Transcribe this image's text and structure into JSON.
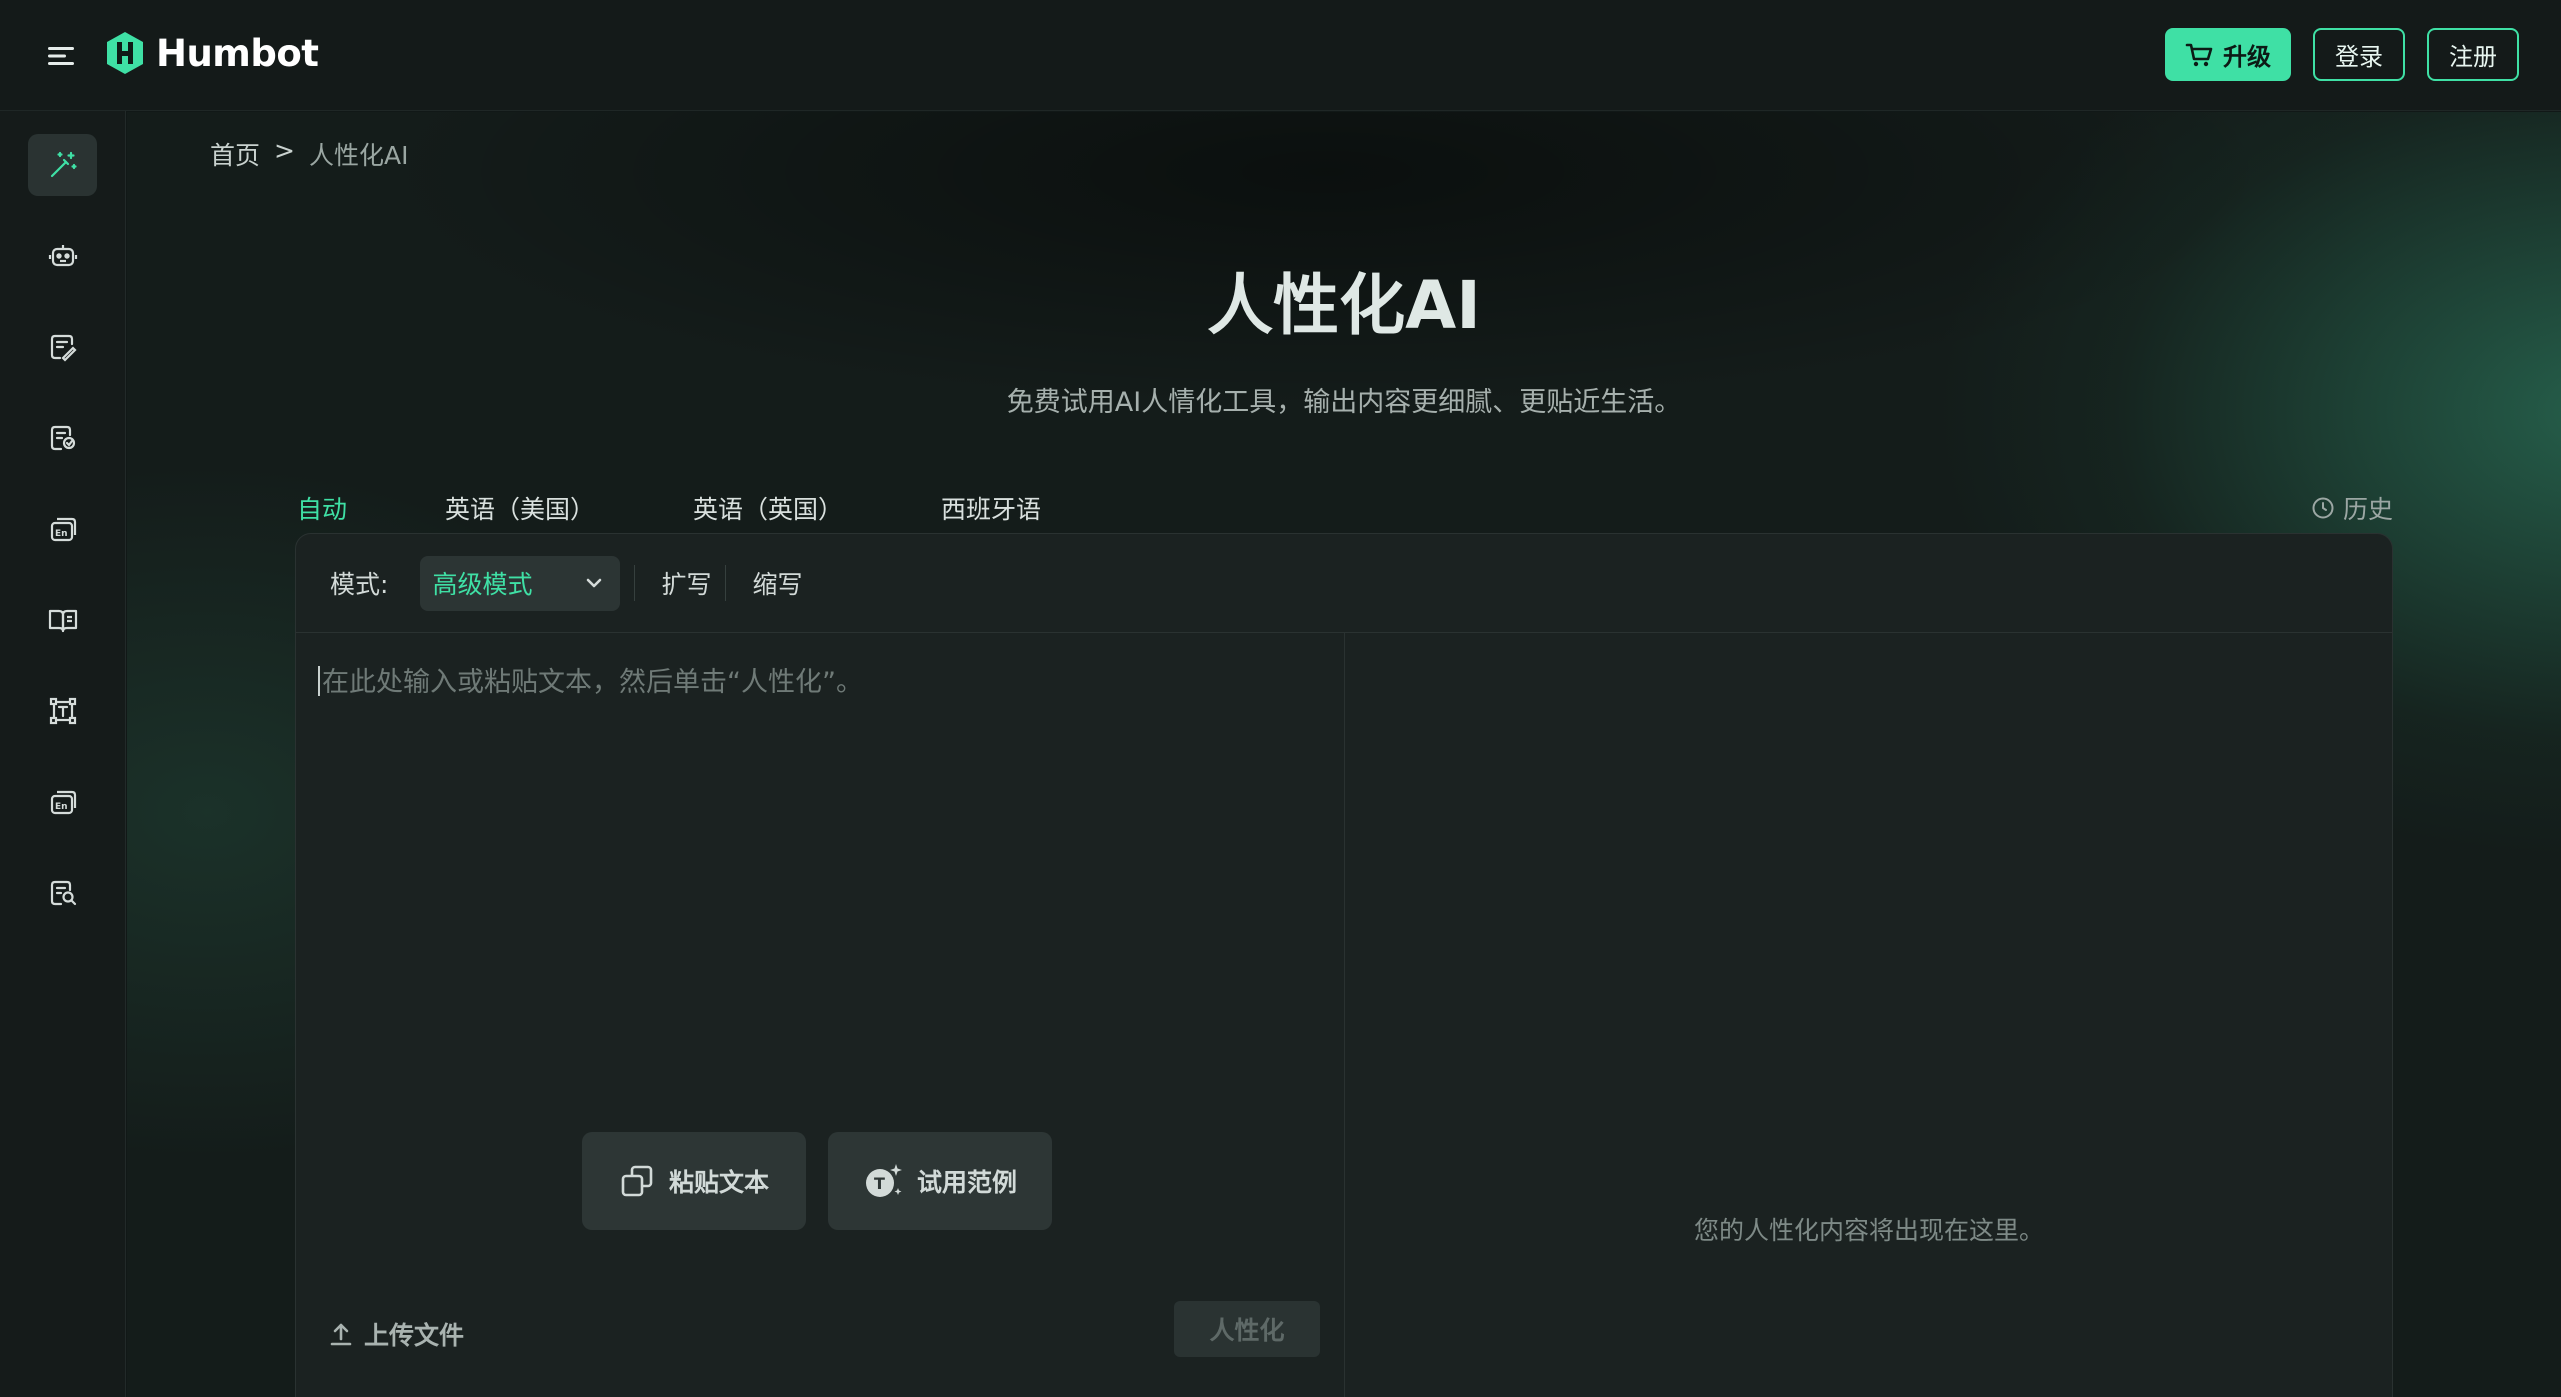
{
  "header": {
    "brand": "Humbot",
    "upgrade_label": "升级",
    "login_label": "登录",
    "register_label": "注册"
  },
  "sidebar": {
    "items": [
      {
        "icon": "magic-wand-icon",
        "active": true
      },
      {
        "icon": "robot-icon",
        "active": false
      },
      {
        "icon": "document-edit-icon",
        "active": false
      },
      {
        "icon": "document-check-icon",
        "active": false
      },
      {
        "icon": "translate-en-icon",
        "active": false
      },
      {
        "icon": "book-icon",
        "active": false
      },
      {
        "icon": "text-frame-icon",
        "active": false
      },
      {
        "icon": "translate-en-icon",
        "active": false
      },
      {
        "icon": "document-search-icon",
        "active": false
      }
    ]
  },
  "breadcrumb": {
    "home": "首页",
    "separator": ">",
    "current": "人性化AI"
  },
  "hero": {
    "title": "人性化AI",
    "subtitle": "免费试用AI人情化工具，输出内容更细腻、更贴近生活。"
  },
  "tabs": [
    {
      "label": "自动",
      "active": true
    },
    {
      "label": "英语（美国）",
      "active": false
    },
    {
      "label": "英语（英国）",
      "active": false
    },
    {
      "label": "西班牙语",
      "active": false
    }
  ],
  "history_label": "历史",
  "toolbar": {
    "mode_label": "模式:",
    "mode_value": "高级模式",
    "expand_label": "扩写",
    "shorten_label": "缩写"
  },
  "editor": {
    "placeholder": "在此处输入或粘贴文本，然后单击“人性化”。",
    "paste_label": "粘贴文本",
    "sample_label": "试用范例",
    "upload_label": "上传文件",
    "humanize_label": "人性化"
  },
  "output": {
    "placeholder": "您的人性化内容将出现在这里。"
  },
  "colors": {
    "accent": "#3fe0a5",
    "background": "#141c1a",
    "panel": "#1b2221"
  }
}
